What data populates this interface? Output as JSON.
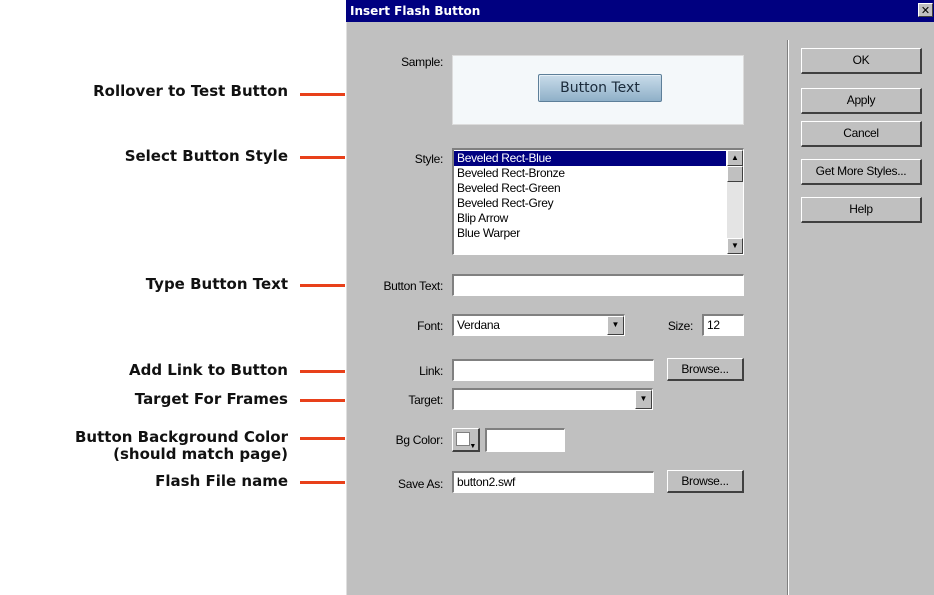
{
  "annotations": {
    "rollover": "Rollover to Test Button",
    "style": "Select Button Style",
    "text": "Type Button Text",
    "link": "Add Link to Button",
    "target": "Target For Frames",
    "bgcolor_line1": "Button Background Color",
    "bgcolor_line2": "(should match page)",
    "filename": "Flash File name"
  },
  "dialog": {
    "title": "Insert Flash Button",
    "close_glyph": "✕",
    "labels": {
      "sample": "Sample:",
      "style": "Style:",
      "button_text": "Button Text:",
      "font": "Font:",
      "size": "Size:",
      "link": "Link:",
      "target": "Target:",
      "bg_color": "Bg Color:",
      "save_as": "Save As:"
    },
    "sample_button_text": "Button Text",
    "styles": [
      "Beveled Rect-Blue",
      "Beveled Rect-Bronze",
      "Beveled Rect-Green",
      "Beveled Rect-Grey",
      "Blip Arrow",
      "Blue Warper"
    ],
    "selected_style": "Beveled Rect-Blue",
    "button_text_value": "",
    "font_value": "Verdana",
    "size_value": "12",
    "link_value": "",
    "target_value": "",
    "bg_color_value": "",
    "save_as_value": "button2.swf",
    "browse_label": "Browse...",
    "buttons": {
      "ok": "OK",
      "apply": "Apply",
      "cancel": "Cancel",
      "more": "Get More Styles...",
      "help": "Help"
    }
  },
  "colors": {
    "title_bar": "#000080",
    "dialog_face": "#c0c0c0",
    "leader_line": "#e8401a",
    "selection": "#000080"
  },
  "icons": {
    "scroll_up": "triangle-up-icon",
    "scroll_down": "triangle-down-icon",
    "dropdown": "triangle-down-icon"
  }
}
